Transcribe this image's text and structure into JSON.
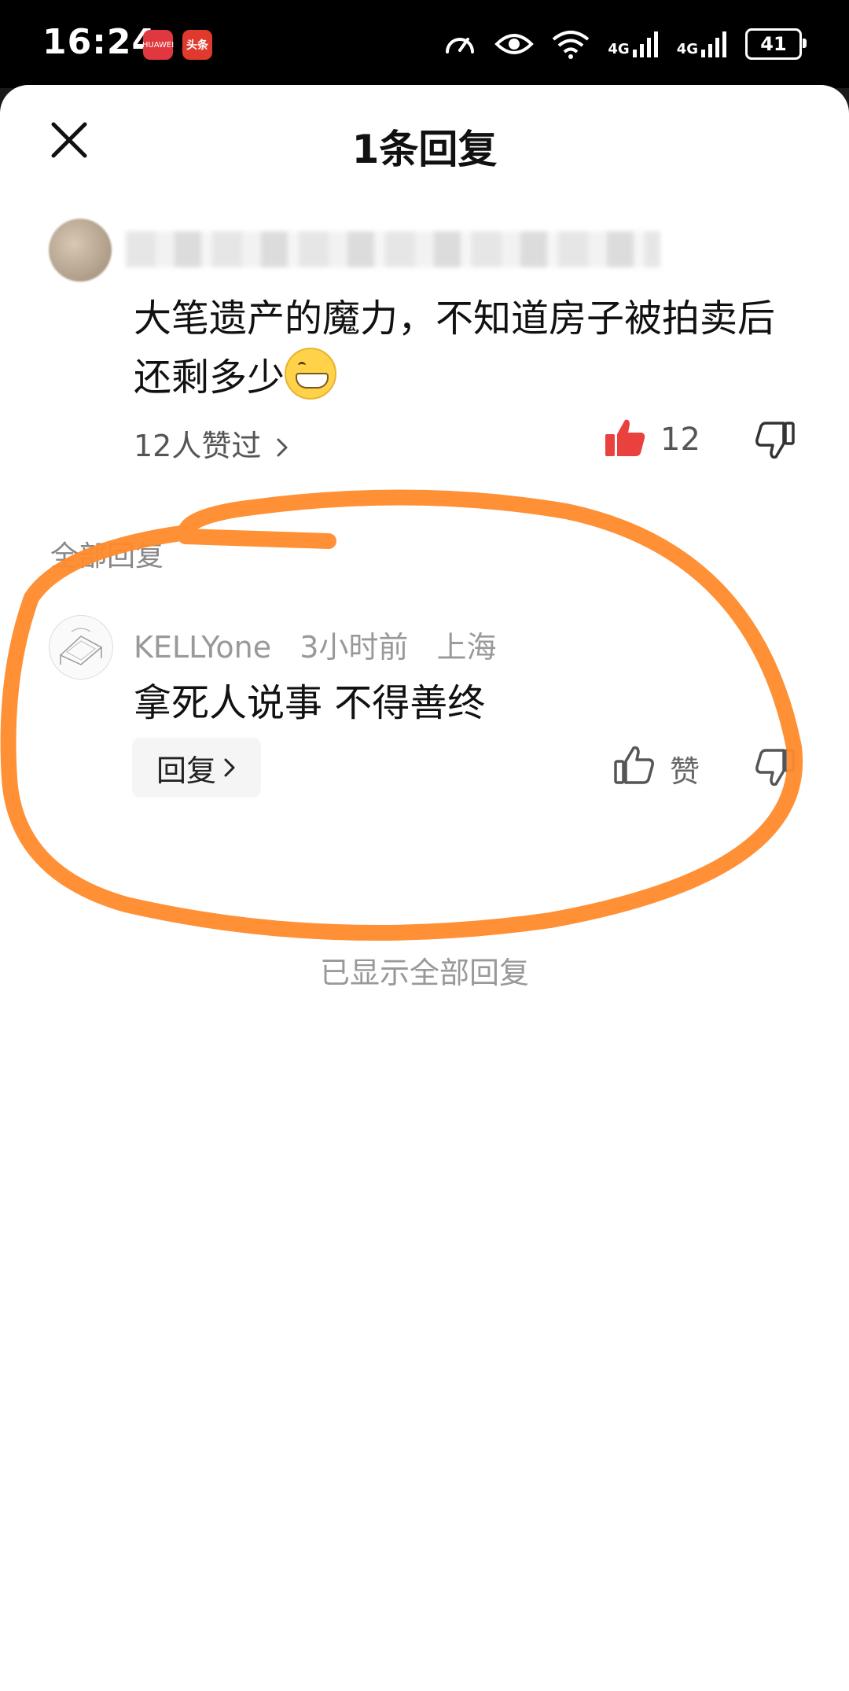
{
  "status_bar": {
    "time": "16:24",
    "apps": [
      "HUAWEI",
      "头条"
    ],
    "network_1": "4G",
    "network_2": "4G",
    "battery": "41"
  },
  "sheet": {
    "title": "1条回复"
  },
  "comment": {
    "text": "大笔遗产的魔力，不知道房子被拍卖后还剩多少",
    "likes_link": "12人赞过",
    "like_count": "12"
  },
  "replies_section": {
    "label": "全部回复"
  },
  "reply": {
    "username": "KELLYone",
    "time": "3小时前",
    "location": "上海",
    "text": "拿死人说事 不得善终",
    "reply_button": "回复",
    "like_label": "赞"
  },
  "footer": {
    "all_shown": "已显示全部回复"
  },
  "colors": {
    "accent_like": "#e8413e",
    "annotation": "#ff8a2a"
  },
  "icons": {
    "close": "close-icon",
    "thumb_up_filled": "thumb-up-filled-icon",
    "thumb_up": "thumb-up-icon",
    "thumb_down": "thumb-down-icon",
    "chevron": "chevron-right-icon"
  }
}
